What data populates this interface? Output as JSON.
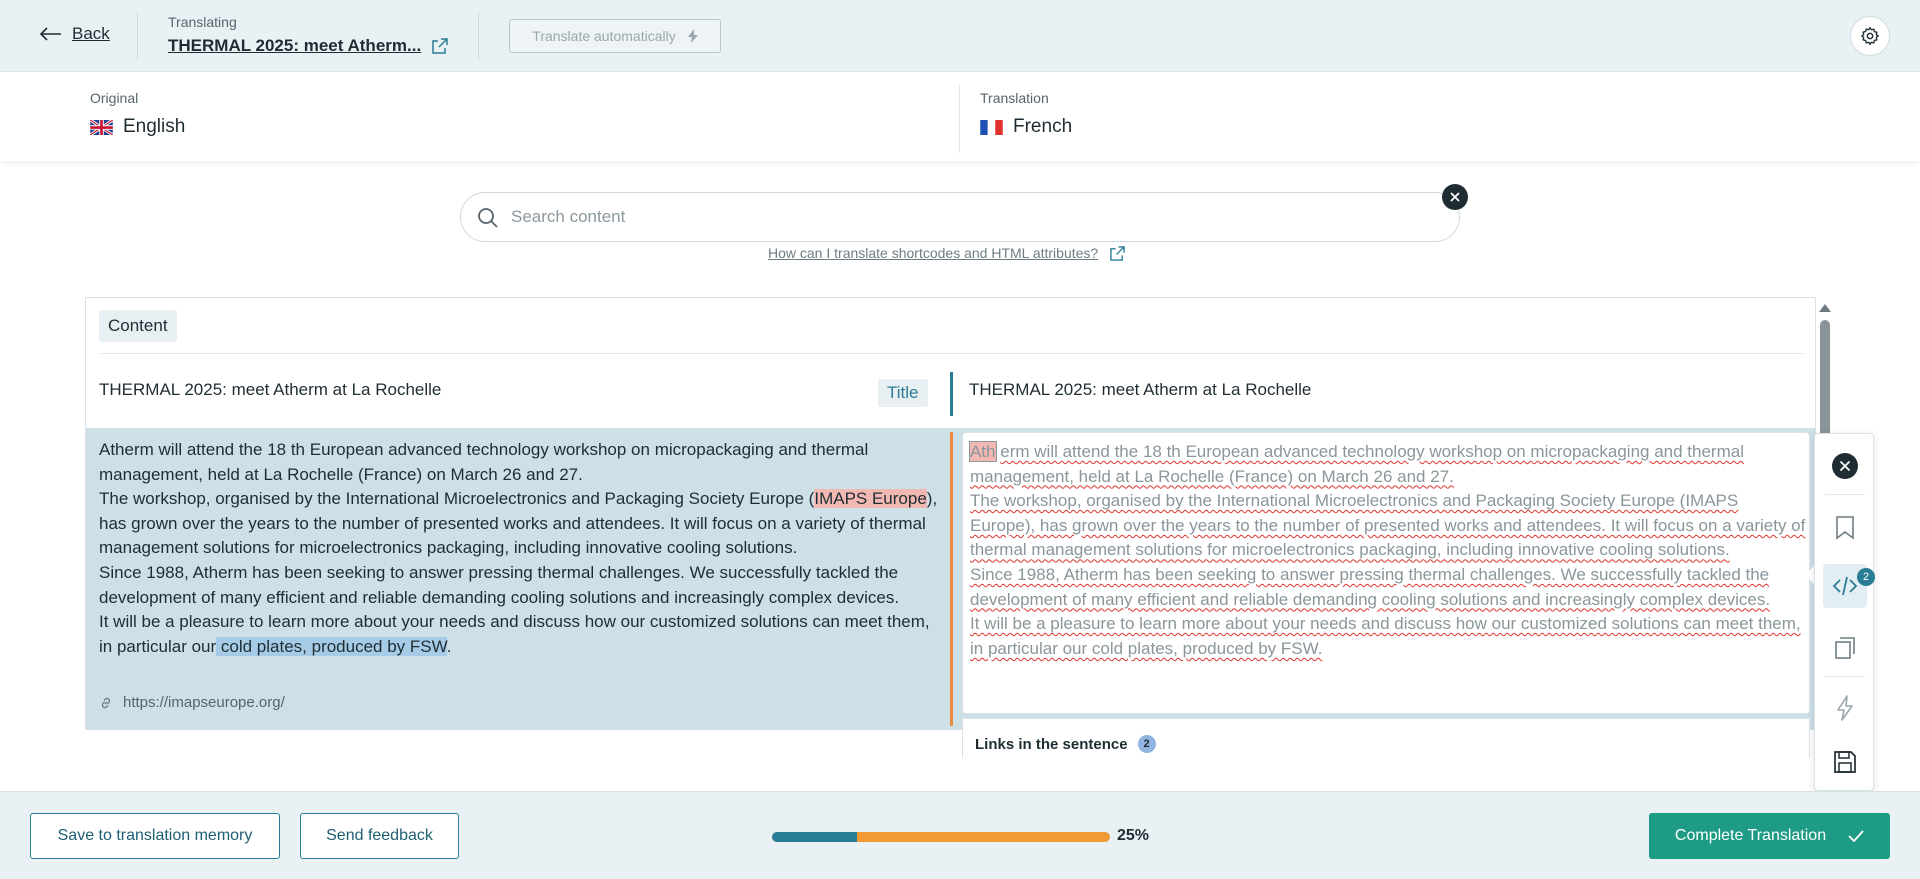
{
  "header": {
    "back_label": "Back",
    "translating_label": "Translating",
    "document_title": "THERMAL 2025: meet Atherm...",
    "auto_translate_label": "Translate automatically"
  },
  "languages": {
    "original_label": "Original",
    "original_name": "English",
    "translation_label": "Translation",
    "translation_name": "French"
  },
  "search": {
    "placeholder": "Search content",
    "value": "",
    "help_link": "How can I translate shortcodes and HTML attributes?"
  },
  "content": {
    "section_chip": "Content",
    "title_source": "THERMAL 2025: meet Atherm at La Rochelle",
    "title_badge": "Title",
    "title_target": "THERMAL 2025: meet Atherm at La Rochelle",
    "source_paragraph": {
      "p1": "Atherm will attend the 18 th European advanced technology workshop on micropackaging and thermal management, held at La Rochelle (France) on March 26 and 27.",
      "p2_before": "The workshop, organised by the International Microelectronics and Packaging Society Europe (",
      "p2_highlight": "IMAPS Europe",
      "p2_after": "), has grown over the years to the number of presented works and attendees. It will focus on a variety of thermal management solutions for microelectronics packaging, including innovative cooling solutions.",
      "p3": "Since 1988, Atherm has been seeking to answer pressing thermal challenges. We successfully tackled the development of many efficient and reliable demanding cooling solutions and increasingly complex devices.",
      "p4_before": "It will be a pleasure to learn more about your needs and discuss how our customized solutions can meet them, in particular our",
      "p4_highlight": " cold plates, produced by FSW",
      "p4_after": "."
    },
    "source_link": "https://imapseurope.org/",
    "target_paragraph": {
      "caret_word": "Ath",
      "t1_rest": "erm will attend the 18 th European advanced technology workshop on micropackaging and thermal management, held at La Rochelle (France) on March 26 and 27.",
      "t2": "The workshop, organised by the International Microelectronics and Packaging Society Europe (IMAPS Europe), has grown over the years to the number of presented works and attendees. It will focus on a variety of thermal management solutions for microelectronics packaging, including innovative cooling solutions.",
      "t3": "Since 1988, Atherm has been seeking to answer pressing thermal challenges. We successfully tackled the development of many efficient and reliable demanding cooling solutions and increasingly complex devices.",
      "t4": "It will be a pleasure to learn more about your needs and discuss how our customized solutions can meet them, in particular our cold plates, produced by FSW."
    },
    "links_title": "Links in the sentence",
    "links_count": "2"
  },
  "tool_rail": {
    "shortcodes_badge": "2"
  },
  "footer": {
    "save_memory_label": "Save to translation memory",
    "feedback_label": "Send feedback",
    "progress_percent_label": "25%",
    "progress_value": 0.25,
    "complete_label": "Complete Translation"
  },
  "colors": {
    "accent_teal": "#2a7d96",
    "progress_orange": "#ef9a33",
    "complete_green": "#1e9b84",
    "segment_bg": "#cde0e7"
  }
}
